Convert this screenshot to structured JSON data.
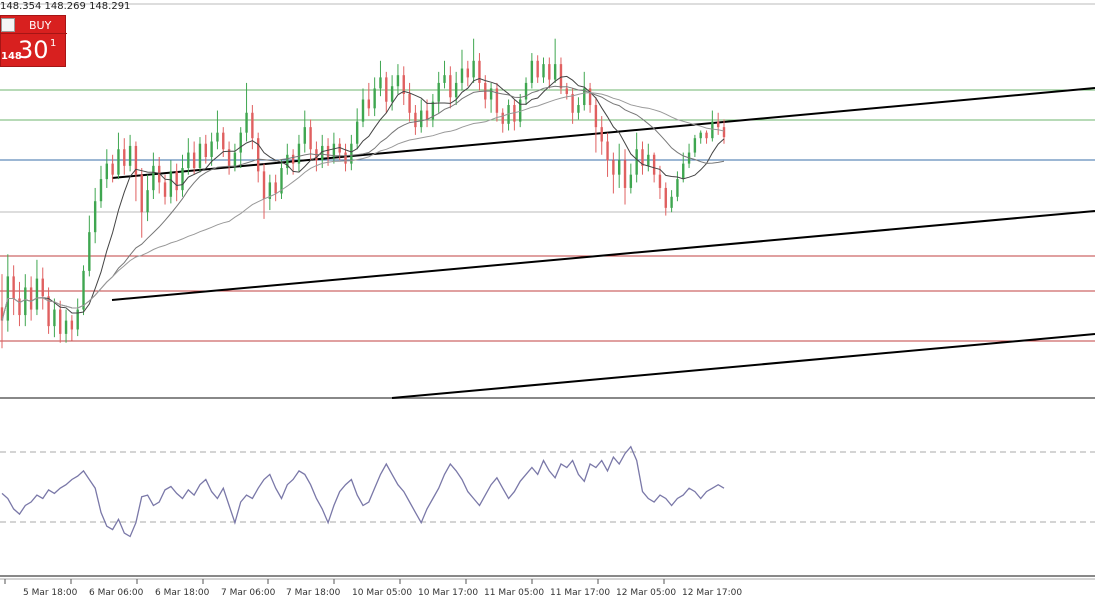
{
  "header": {
    "ohlc_text": "148.354 148.269 148.291"
  },
  "trade_panel": {
    "buy_label": "BUY",
    "price_prefix": "148",
    "price_big": "30",
    "price_sup": "1",
    "accent_color": "#d8201f"
  },
  "chart_data": {
    "type": "candlestick",
    "x_tick_labels": [
      "5 Mar 18:00",
      "6 Mar 06:00",
      "6 Mar 18:00",
      "7 Mar 06:00",
      "7 Mar 18:00",
      "10 Mar 05:00",
      "10 Mar 17:00",
      "11 Mar 05:00",
      "11 Mar 17:00",
      "12 Mar 05:00",
      "12 Mar 17:00"
    ],
    "price_series": [
      {
        "i": 0,
        "o": 142,
        "c": 130,
        "h": 105,
        "l": 172
      },
      {
        "i": 1,
        "o": 130,
        "c": 170,
        "h": 120,
        "l": 190
      },
      {
        "i": 2,
        "o": 170,
        "c": 150,
        "h": 135,
        "l": 180
      },
      {
        "i": 3,
        "o": 150,
        "c": 135,
        "h": 125,
        "l": 165
      },
      {
        "i": 4,
        "o": 135,
        "c": 160,
        "h": 125,
        "l": 172
      },
      {
        "i": 5,
        "o": 160,
        "c": 140,
        "h": 130,
        "l": 170
      },
      {
        "i": 6,
        "o": 140,
        "c": 168,
        "h": 135,
        "l": 185
      },
      {
        "i": 7,
        "o": 168,
        "c": 152,
        "h": 140,
        "l": 178
      },
      {
        "i": 8,
        "o": 152,
        "c": 125,
        "h": 118,
        "l": 160
      },
      {
        "i": 9,
        "o": 125,
        "c": 140,
        "h": 115,
        "l": 150
      },
      {
        "i": 10,
        "o": 140,
        "c": 118,
        "h": 110,
        "l": 148
      },
      {
        "i": 11,
        "o": 118,
        "c": 130,
        "h": 110,
        "l": 140
      },
      {
        "i": 12,
        "o": 130,
        "c": 122,
        "h": 112,
        "l": 135
      },
      {
        "i": 13,
        "o": 122,
        "c": 140,
        "h": 116,
        "l": 150
      },
      {
        "i": 14,
        "o": 140,
        "c": 175,
        "h": 135,
        "l": 180
      },
      {
        "i": 15,
        "o": 175,
        "c": 210,
        "h": 170,
        "l": 225
      },
      {
        "i": 16,
        "o": 210,
        "c": 238,
        "h": 200,
        "l": 250
      },
      {
        "i": 17,
        "o": 238,
        "c": 258,
        "h": 232,
        "l": 270
      },
      {
        "i": 18,
        "o": 258,
        "c": 272,
        "h": 250,
        "l": 285
      },
      {
        "i": 19,
        "o": 272,
        "c": 262,
        "h": 255,
        "l": 280
      },
      {
        "i": 20,
        "o": 262,
        "c": 285,
        "h": 258,
        "l": 300
      },
      {
        "i": 21,
        "o": 285,
        "c": 270,
        "h": 262,
        "l": 295
      },
      {
        "i": 22,
        "o": 270,
        "c": 288,
        "h": 265,
        "l": 298
      },
      {
        "i": 23,
        "o": 288,
        "c": 262,
        "h": 238,
        "l": 292
      },
      {
        "i": 24,
        "o": 262,
        "c": 228,
        "h": 205,
        "l": 268
      },
      {
        "i": 25,
        "o": 228,
        "c": 248,
        "h": 220,
        "l": 262
      },
      {
        "i": 26,
        "o": 248,
        "c": 270,
        "h": 240,
        "l": 282
      },
      {
        "i": 27,
        "o": 270,
        "c": 255,
        "h": 245,
        "l": 278
      },
      {
        "i": 28,
        "o": 255,
        "c": 242,
        "h": 235,
        "l": 262
      },
      {
        "i": 29,
        "o": 242,
        "c": 265,
        "h": 236,
        "l": 275
      },
      {
        "i": 30,
        "o": 265,
        "c": 248,
        "h": 238,
        "l": 272
      },
      {
        "i": 31,
        "o": 248,
        "c": 268,
        "h": 242,
        "l": 280
      },
      {
        "i": 32,
        "o": 268,
        "c": 282,
        "h": 262,
        "l": 295
      },
      {
        "i": 33,
        "o": 282,
        "c": 268,
        "h": 262,
        "l": 292
      },
      {
        "i": 34,
        "o": 268,
        "c": 290,
        "h": 264,
        "l": 296
      },
      {
        "i": 35,
        "o": 290,
        "c": 278,
        "h": 272,
        "l": 298
      },
      {
        "i": 36,
        "o": 278,
        "c": 292,
        "h": 270,
        "l": 300
      },
      {
        "i": 37,
        "o": 292,
        "c": 300,
        "h": 285,
        "l": 320
      },
      {
        "i": 38,
        "o": 300,
        "c": 285,
        "h": 278,
        "l": 305
      },
      {
        "i": 39,
        "o": 285,
        "c": 270,
        "h": 262,
        "l": 292
      },
      {
        "i": 40,
        "o": 270,
        "c": 282,
        "h": 265,
        "l": 290
      },
      {
        "i": 41,
        "o": 282,
        "c": 300,
        "h": 268,
        "l": 305
      },
      {
        "i": 42,
        "o": 300,
        "c": 318,
        "h": 292,
        "l": 345
      },
      {
        "i": 43,
        "o": 318,
        "c": 295,
        "h": 285,
        "l": 325
      },
      {
        "i": 44,
        "o": 295,
        "c": 265,
        "h": 255,
        "l": 300
      },
      {
        "i": 45,
        "o": 265,
        "c": 240,
        "h": 222,
        "l": 272
      },
      {
        "i": 46,
        "o": 240,
        "c": 255,
        "h": 230,
        "l": 262
      },
      {
        "i": 47,
        "o": 255,
        "c": 245,
        "h": 238,
        "l": 262
      },
      {
        "i": 48,
        "o": 245,
        "c": 268,
        "h": 240,
        "l": 275
      },
      {
        "i": 49,
        "o": 268,
        "c": 280,
        "h": 262,
        "l": 290
      },
      {
        "i": 50,
        "o": 280,
        "c": 272,
        "h": 262,
        "l": 285
      },
      {
        "i": 51,
        "o": 272,
        "c": 290,
        "h": 265,
        "l": 298
      },
      {
        "i": 52,
        "o": 290,
        "c": 305,
        "h": 282,
        "l": 320
      },
      {
        "i": 53,
        "o": 305,
        "c": 285,
        "h": 275,
        "l": 312
      },
      {
        "i": 54,
        "o": 285,
        "c": 275,
        "h": 265,
        "l": 292
      },
      {
        "i": 55,
        "o": 275,
        "c": 288,
        "h": 268,
        "l": 298
      },
      {
        "i": 56,
        "o": 288,
        "c": 278,
        "h": 270,
        "l": 295
      },
      {
        "i": 57,
        "o": 278,
        "c": 290,
        "h": 272,
        "l": 300
      },
      {
        "i": 58,
        "o": 290,
        "c": 282,
        "h": 275,
        "l": 295
      },
      {
        "i": 59,
        "o": 282,
        "c": 272,
        "h": 265,
        "l": 290
      },
      {
        "i": 60,
        "o": 272,
        "c": 290,
        "h": 266,
        "l": 298
      },
      {
        "i": 61,
        "o": 290,
        "c": 310,
        "h": 285,
        "l": 322
      },
      {
        "i": 62,
        "o": 310,
        "c": 330,
        "h": 305,
        "l": 340
      },
      {
        "i": 63,
        "o": 330,
        "c": 322,
        "h": 315,
        "l": 345
      },
      {
        "i": 64,
        "o": 322,
        "c": 340,
        "h": 315,
        "l": 350
      },
      {
        "i": 65,
        "o": 340,
        "c": 350,
        "h": 333,
        "l": 365
      },
      {
        "i": 66,
        "o": 350,
        "c": 328,
        "h": 318,
        "l": 355
      },
      {
        "i": 67,
        "o": 328,
        "c": 342,
        "h": 320,
        "l": 352
      },
      {
        "i": 68,
        "o": 342,
        "c": 352,
        "h": 335,
        "l": 362
      },
      {
        "i": 69,
        "o": 352,
        "c": 335,
        "h": 325,
        "l": 360
      },
      {
        "i": 70,
        "o": 335,
        "c": 318,
        "h": 310,
        "l": 345
      },
      {
        "i": 71,
        "o": 318,
        "c": 305,
        "h": 298,
        "l": 325
      },
      {
        "i": 72,
        "o": 305,
        "c": 320,
        "h": 300,
        "l": 330
      },
      {
        "i": 73,
        "o": 320,
        "c": 312,
        "h": 305,
        "l": 330
      },
      {
        "i": 74,
        "o": 312,
        "c": 328,
        "h": 305,
        "l": 335
      },
      {
        "i": 75,
        "o": 328,
        "c": 345,
        "h": 318,
        "l": 355
      },
      {
        "i": 76,
        "o": 345,
        "c": 352,
        "h": 340,
        "l": 365
      },
      {
        "i": 77,
        "o": 352,
        "c": 332,
        "h": 322,
        "l": 360
      },
      {
        "i": 78,
        "o": 332,
        "c": 345,
        "h": 325,
        "l": 355
      },
      {
        "i": 79,
        "o": 345,
        "c": 358,
        "h": 338,
        "l": 375
      },
      {
        "i": 80,
        "o": 358,
        "c": 350,
        "h": 342,
        "l": 365
      },
      {
        "i": 81,
        "o": 350,
        "c": 365,
        "h": 345,
        "l": 385
      },
      {
        "i": 82,
        "o": 365,
        "c": 345,
        "h": 338,
        "l": 372
      },
      {
        "i": 83,
        "o": 345,
        "c": 330,
        "h": 322,
        "l": 352
      },
      {
        "i": 84,
        "o": 330,
        "c": 340,
        "h": 318,
        "l": 345
      },
      {
        "i": 85,
        "o": 340,
        "c": 318,
        "h": 310,
        "l": 345
      },
      {
        "i": 86,
        "o": 318,
        "c": 308,
        "h": 300,
        "l": 322
      },
      {
        "i": 87,
        "o": 308,
        "c": 325,
        "h": 302,
        "l": 330
      },
      {
        "i": 88,
        "o": 325,
        "c": 310,
        "h": 302,
        "l": 330
      },
      {
        "i": 89,
        "o": 310,
        "c": 330,
        "h": 305,
        "l": 335
      },
      {
        "i": 90,
        "o": 330,
        "c": 345,
        "h": 325,
        "l": 350
      },
      {
        "i": 91,
        "o": 345,
        "c": 365,
        "h": 340,
        "l": 372
      },
      {
        "i": 92,
        "o": 365,
        "c": 350,
        "h": 345,
        "l": 370
      },
      {
        "i": 93,
        "o": 350,
        "c": 362,
        "h": 345,
        "l": 368
      },
      {
        "i": 94,
        "o": 362,
        "c": 348,
        "h": 340,
        "l": 368
      },
      {
        "i": 95,
        "o": 348,
        "c": 362,
        "h": 345,
        "l": 385
      },
      {
        "i": 96,
        "o": 362,
        "c": 340,
        "h": 335,
        "l": 368
      },
      {
        "i": 97,
        "o": 340,
        "c": 335,
        "h": 330,
        "l": 345
      },
      {
        "i": 98,
        "o": 335,
        "c": 318,
        "h": 308,
        "l": 340
      },
      {
        "i": 99,
        "o": 318,
        "c": 325,
        "h": 312,
        "l": 332
      },
      {
        "i": 100,
        "o": 325,
        "c": 340,
        "h": 320,
        "l": 355
      },
      {
        "i": 101,
        "o": 340,
        "c": 325,
        "h": 318,
        "l": 345
      },
      {
        "i": 102,
        "o": 325,
        "c": 305,
        "h": 282,
        "l": 332
      },
      {
        "i": 103,
        "o": 305,
        "c": 292,
        "h": 280,
        "l": 315
      },
      {
        "i": 104,
        "o": 292,
        "c": 275,
        "h": 260,
        "l": 300
      },
      {
        "i": 105,
        "o": 275,
        "c": 262,
        "h": 245,
        "l": 282
      },
      {
        "i": 106,
        "o": 262,
        "c": 275,
        "h": 250,
        "l": 290
      },
      {
        "i": 107,
        "o": 275,
        "c": 250,
        "h": 235,
        "l": 285
      },
      {
        "i": 108,
        "o": 250,
        "c": 262,
        "h": 245,
        "l": 272
      },
      {
        "i": 109,
        "o": 262,
        "c": 285,
        "h": 255,
        "l": 300
      },
      {
        "i": 110,
        "o": 285,
        "c": 270,
        "h": 262,
        "l": 292
      },
      {
        "i": 111,
        "o": 270,
        "c": 280,
        "h": 265,
        "l": 290
      },
      {
        "i": 112,
        "o": 280,
        "c": 262,
        "h": 255,
        "l": 282
      },
      {
        "i": 113,
        "o": 262,
        "c": 250,
        "h": 240,
        "l": 270
      },
      {
        "i": 114,
        "o": 250,
        "c": 232,
        "h": 225,
        "l": 255
      },
      {
        "i": 115,
        "o": 232,
        "c": 242,
        "h": 228,
        "l": 248
      },
      {
        "i": 116,
        "o": 242,
        "c": 258,
        "h": 238,
        "l": 265
      },
      {
        "i": 117,
        "o": 258,
        "c": 272,
        "h": 255,
        "l": 282
      },
      {
        "i": 118,
        "o": 272,
        "c": 282,
        "h": 268,
        "l": 290
      },
      {
        "i": 119,
        "o": 282,
        "c": 295,
        "h": 278,
        "l": 298
      },
      {
        "i": 120,
        "o": 295,
        "c": 300,
        "h": 290,
        "l": 302
      },
      {
        "i": 121,
        "o": 300,
        "c": 295,
        "h": 290,
        "l": 302
      },
      {
        "i": 122,
        "o": 295,
        "c": 310,
        "h": 292,
        "l": 320
      },
      {
        "i": 123,
        "o": 310,
        "c": 305,
        "h": 298,
        "l": 318
      },
      {
        "i": 124,
        "o": 305,
        "c": 296,
        "h": 290,
        "l": 312
      }
    ],
    "overlays": {
      "upper_channel_line": "black",
      "lower_channel_line": "black",
      "green_levels": 2,
      "blue_levels": 1,
      "red_levels": 3,
      "moving_averages": 3
    },
    "oscillator": {
      "type": "line",
      "color": "#7a78a8",
      "grid": "dashed-levels",
      "values": [
        47,
        44,
        38,
        35,
        40,
        42,
        46,
        44,
        49,
        47,
        50,
        52,
        55,
        57,
        60,
        55,
        50,
        36,
        28,
        26,
        32,
        24,
        22,
        30,
        45,
        46,
        40,
        42,
        49,
        51,
        47,
        44,
        49,
        46,
        52,
        55,
        48,
        44,
        50,
        40,
        30,
        42,
        46,
        44,
        50,
        55,
        58,
        50,
        44,
        52,
        55,
        60,
        58,
        52,
        44,
        38,
        30,
        40,
        48,
        52,
        55,
        46,
        40,
        42,
        50,
        58,
        64,
        58,
        52,
        48,
        42,
        36,
        30,
        38,
        44,
        50,
        58,
        64,
        60,
        55,
        48,
        44,
        40,
        46,
        52,
        56,
        50,
        44,
        48,
        54,
        58,
        62,
        58,
        66,
        60,
        56,
        64,
        62,
        66,
        58,
        54,
        64,
        62,
        66,
        60,
        68,
        64,
        70,
        74,
        66,
        48,
        44,
        42,
        46,
        44,
        40,
        44,
        46,
        50,
        48,
        44,
        48,
        50,
        52,
        50
      ]
    }
  }
}
